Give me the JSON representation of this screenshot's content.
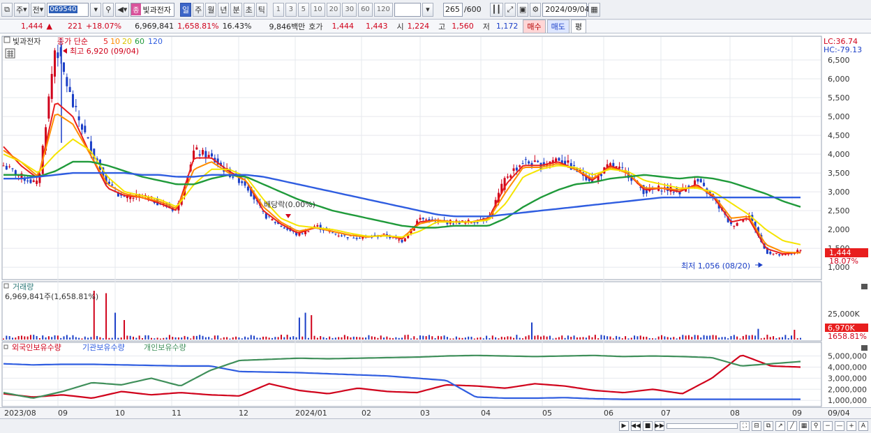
{
  "toolbar": {
    "market": "주",
    "prev": "전",
    "code": "069540",
    "name_tag": "종",
    "name": "빛과전자",
    "periods": [
      "일",
      "주",
      "월",
      "년",
      "분",
      "초",
      "틱"
    ],
    "active_period": "일",
    "intervals": [
      "1",
      "3",
      "5",
      "10",
      "20",
      "30",
      "60",
      "120"
    ],
    "count": "265",
    "max_count": "/600",
    "date": "2024/09/04"
  },
  "quote": {
    "price": "1,444",
    "arrow": "▲",
    "change": "221",
    "change_pct": "+18.07%",
    "volume": "6,969,841",
    "volume_ratio": "1,658.81%",
    "turnover": "16.43%",
    "amount": "9,846백만",
    "bid_label": "호가",
    "ask": "1,444",
    "bid": "1,443",
    "open_label": "시",
    "open": "1,224",
    "high_label": "고",
    "high": "1,560",
    "low_label": "저",
    "low": "1,172",
    "buy_label": "매수",
    "sell_label": "매도",
    "eval_label": "평"
  },
  "price_panel": {
    "title": "빛과전자",
    "legend_prefix": "종가 단순",
    "ma": [
      {
        "label": "5",
        "color": "#e81e1e"
      },
      {
        "label": "10",
        "color": "#ff8c00"
      },
      {
        "label": "20",
        "color": "#f5e400"
      },
      {
        "label": "60",
        "color": "#1f9a3a"
      },
      {
        "label": "120",
        "color": "#2f5de0"
      }
    ],
    "lc": "LC:36.74",
    "hc": "HC:-79.13",
    "high_marker": "최고 6,920 (09/04)",
    "low_marker": "최저 1,056 (08/20)",
    "dividend_marker": "배당락(0.00%)",
    "price_tag": "1,444",
    "pct_tag": "18.07%",
    "y_ticks": [
      "6,500",
      "6,000",
      "5,500",
      "5,000",
      "4,500",
      "4,000",
      "3,500",
      "3,000",
      "2,500",
      "2,000",
      "1,500",
      "1,000"
    ]
  },
  "volume_panel": {
    "title": "거래량",
    "value": "6,969,841주(1,658.81%)",
    "y_tick": "25,000K",
    "tag_value": "6,970K",
    "tag_pct": "1658.81%"
  },
  "holding_panel": {
    "legend": [
      {
        "label": "외국인보유수량",
        "color": "#d0021b"
      },
      {
        "label": "기관보유수량",
        "color": "#2f5de0"
      },
      {
        "label": "개인보유수량",
        "color": "#3f8f5a"
      }
    ],
    "y_ticks": [
      "5,000,000",
      "4,000,000",
      "3,000,000",
      "2,000,000",
      "1,000,000"
    ]
  },
  "x_axis": {
    "labels": [
      "2023/08",
      "09",
      "10",
      "11",
      "12",
      "2024/01",
      "02",
      "03",
      "04",
      "05",
      "06",
      "07",
      "08",
      "09",
      "09/04"
    ]
  },
  "chart_data": {
    "type": "line",
    "title": "빛과전자",
    "x_range": [
      "2023/08",
      "2024/09/04"
    ],
    "ylim": [
      1000,
      6900
    ],
    "series": [
      {
        "name": "종가",
        "values": [
          3700,
          3400,
          3200,
          6920,
          5300,
          4200,
          3200,
          2800,
          2900,
          2700,
          2500,
          4100,
          3900,
          3500,
          3200,
          2400,
          2100,
          1850,
          2100,
          1900,
          1800,
          1800,
          1850,
          1700,
          2300,
          2200,
          2200,
          2200,
          2300,
          3400,
          3800,
          3700,
          3900,
          3600,
          3300,
          3700,
          3500,
          3000,
          3100,
          3000,
          3300,
          2800,
          2100,
          2400,
          1400,
          1300,
          1444
        ]
      },
      {
        "name": "5",
        "values": [
          4200,
          3700,
          3350,
          5400,
          5000,
          4000,
          3100,
          2900,
          2850,
          2700,
          2500,
          3900,
          3900,
          3550,
          3300,
          2500,
          2150,
          1900,
          2050,
          1950,
          1850,
          1800,
          1850,
          1750,
          2200,
          2250,
          2200,
          2200,
          2300,
          3200,
          3700,
          3700,
          3800,
          3600,
          3300,
          3700,
          3500,
          3050,
          3100,
          3000,
          3200,
          2850,
          2200,
          2300,
          1500,
          1350,
          1400
        ]
      },
      {
        "name": "10",
        "values": [
          4100,
          3800,
          3400,
          5100,
          4800,
          4000,
          3200,
          2950,
          2850,
          2750,
          2550,
          3600,
          3800,
          3500,
          3300,
          2600,
          2200,
          1950,
          2050,
          1950,
          1850,
          1800,
          1850,
          1780,
          2150,
          2250,
          2200,
          2200,
          2280,
          3000,
          3650,
          3650,
          3750,
          3600,
          3350,
          3650,
          3500,
          3100,
          3100,
          3050,
          3150,
          2900,
          2300,
          2350,
          1600,
          1400,
          1380
        ]
      },
      {
        "name": "20",
        "values": [
          4000,
          3800,
          3500,
          4000,
          4400,
          4100,
          3400,
          3000,
          2900,
          2800,
          2600,
          3200,
          3600,
          3600,
          3400,
          2800,
          2300,
          2100,
          2050,
          2000,
          1900,
          1820,
          1830,
          1800,
          1950,
          2200,
          2200,
          2200,
          2250,
          2700,
          3400,
          3600,
          3700,
          3650,
          3450,
          3600,
          3550,
          3300,
          3200,
          3100,
          3100,
          3000,
          2700,
          2400,
          2000,
          1700,
          1600
        ]
      },
      {
        "name": "60",
        "values": [
          3450,
          3450,
          3400,
          3550,
          3800,
          3800,
          3700,
          3550,
          3400,
          3300,
          3200,
          3200,
          3350,
          3450,
          3400,
          3200,
          3000,
          2800,
          2650,
          2500,
          2400,
          2300,
          2200,
          2100,
          2050,
          2050,
          2100,
          2100,
          2100,
          2300,
          2600,
          2850,
          3050,
          3200,
          3250,
          3350,
          3400,
          3450,
          3400,
          3350,
          3400,
          3350,
          3250,
          3100,
          2950,
          2750,
          2600
        ]
      },
      {
        "name": "120",
        "values": [
          3350,
          3350,
          3400,
          3450,
          3500,
          3500,
          3500,
          3500,
          3450,
          3450,
          3400,
          3400,
          3450,
          3450,
          3450,
          3400,
          3300,
          3200,
          3100,
          3000,
          2900,
          2800,
          2700,
          2600,
          2500,
          2400,
          2350,
          2350,
          2350,
          2400,
          2450,
          2500,
          2550,
          2600,
          2650,
          2700,
          2750,
          2800,
          2850,
          2850,
          2850,
          2850,
          2850,
          2850,
          2850,
          2850,
          2850
        ]
      }
    ]
  }
}
